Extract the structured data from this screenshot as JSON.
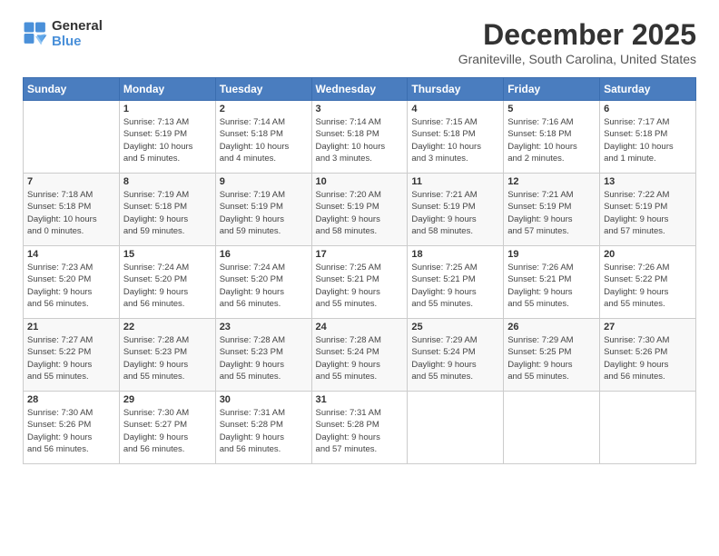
{
  "logo": {
    "line1": "General",
    "line2": "Blue"
  },
  "title": "December 2025",
  "subtitle": "Graniteville, South Carolina, United States",
  "days_of_week": [
    "Sunday",
    "Monday",
    "Tuesday",
    "Wednesday",
    "Thursday",
    "Friday",
    "Saturday"
  ],
  "weeks": [
    [
      {
        "day": "",
        "info": ""
      },
      {
        "day": "1",
        "info": "Sunrise: 7:13 AM\nSunset: 5:19 PM\nDaylight: 10 hours\nand 5 minutes."
      },
      {
        "day": "2",
        "info": "Sunrise: 7:14 AM\nSunset: 5:18 PM\nDaylight: 10 hours\nand 4 minutes."
      },
      {
        "day": "3",
        "info": "Sunrise: 7:14 AM\nSunset: 5:18 PM\nDaylight: 10 hours\nand 3 minutes."
      },
      {
        "day": "4",
        "info": "Sunrise: 7:15 AM\nSunset: 5:18 PM\nDaylight: 10 hours\nand 3 minutes."
      },
      {
        "day": "5",
        "info": "Sunrise: 7:16 AM\nSunset: 5:18 PM\nDaylight: 10 hours\nand 2 minutes."
      },
      {
        "day": "6",
        "info": "Sunrise: 7:17 AM\nSunset: 5:18 PM\nDaylight: 10 hours\nand 1 minute."
      }
    ],
    [
      {
        "day": "7",
        "info": "Sunrise: 7:18 AM\nSunset: 5:18 PM\nDaylight: 10 hours\nand 0 minutes."
      },
      {
        "day": "8",
        "info": "Sunrise: 7:19 AM\nSunset: 5:18 PM\nDaylight: 9 hours\nand 59 minutes."
      },
      {
        "day": "9",
        "info": "Sunrise: 7:19 AM\nSunset: 5:19 PM\nDaylight: 9 hours\nand 59 minutes."
      },
      {
        "day": "10",
        "info": "Sunrise: 7:20 AM\nSunset: 5:19 PM\nDaylight: 9 hours\nand 58 minutes."
      },
      {
        "day": "11",
        "info": "Sunrise: 7:21 AM\nSunset: 5:19 PM\nDaylight: 9 hours\nand 58 minutes."
      },
      {
        "day": "12",
        "info": "Sunrise: 7:21 AM\nSunset: 5:19 PM\nDaylight: 9 hours\nand 57 minutes."
      },
      {
        "day": "13",
        "info": "Sunrise: 7:22 AM\nSunset: 5:19 PM\nDaylight: 9 hours\nand 57 minutes."
      }
    ],
    [
      {
        "day": "14",
        "info": "Sunrise: 7:23 AM\nSunset: 5:20 PM\nDaylight: 9 hours\nand 56 minutes."
      },
      {
        "day": "15",
        "info": "Sunrise: 7:24 AM\nSunset: 5:20 PM\nDaylight: 9 hours\nand 56 minutes."
      },
      {
        "day": "16",
        "info": "Sunrise: 7:24 AM\nSunset: 5:20 PM\nDaylight: 9 hours\nand 56 minutes."
      },
      {
        "day": "17",
        "info": "Sunrise: 7:25 AM\nSunset: 5:21 PM\nDaylight: 9 hours\nand 55 minutes."
      },
      {
        "day": "18",
        "info": "Sunrise: 7:25 AM\nSunset: 5:21 PM\nDaylight: 9 hours\nand 55 minutes."
      },
      {
        "day": "19",
        "info": "Sunrise: 7:26 AM\nSunset: 5:21 PM\nDaylight: 9 hours\nand 55 minutes."
      },
      {
        "day": "20",
        "info": "Sunrise: 7:26 AM\nSunset: 5:22 PM\nDaylight: 9 hours\nand 55 minutes."
      }
    ],
    [
      {
        "day": "21",
        "info": "Sunrise: 7:27 AM\nSunset: 5:22 PM\nDaylight: 9 hours\nand 55 minutes."
      },
      {
        "day": "22",
        "info": "Sunrise: 7:28 AM\nSunset: 5:23 PM\nDaylight: 9 hours\nand 55 minutes."
      },
      {
        "day": "23",
        "info": "Sunrise: 7:28 AM\nSunset: 5:23 PM\nDaylight: 9 hours\nand 55 minutes."
      },
      {
        "day": "24",
        "info": "Sunrise: 7:28 AM\nSunset: 5:24 PM\nDaylight: 9 hours\nand 55 minutes."
      },
      {
        "day": "25",
        "info": "Sunrise: 7:29 AM\nSunset: 5:24 PM\nDaylight: 9 hours\nand 55 minutes."
      },
      {
        "day": "26",
        "info": "Sunrise: 7:29 AM\nSunset: 5:25 PM\nDaylight: 9 hours\nand 55 minutes."
      },
      {
        "day": "27",
        "info": "Sunrise: 7:30 AM\nSunset: 5:26 PM\nDaylight: 9 hours\nand 56 minutes."
      }
    ],
    [
      {
        "day": "28",
        "info": "Sunrise: 7:30 AM\nSunset: 5:26 PM\nDaylight: 9 hours\nand 56 minutes."
      },
      {
        "day": "29",
        "info": "Sunrise: 7:30 AM\nSunset: 5:27 PM\nDaylight: 9 hours\nand 56 minutes."
      },
      {
        "day": "30",
        "info": "Sunrise: 7:31 AM\nSunset: 5:28 PM\nDaylight: 9 hours\nand 56 minutes."
      },
      {
        "day": "31",
        "info": "Sunrise: 7:31 AM\nSunset: 5:28 PM\nDaylight: 9 hours\nand 57 minutes."
      },
      {
        "day": "",
        "info": ""
      },
      {
        "day": "",
        "info": ""
      },
      {
        "day": "",
        "info": ""
      }
    ]
  ]
}
